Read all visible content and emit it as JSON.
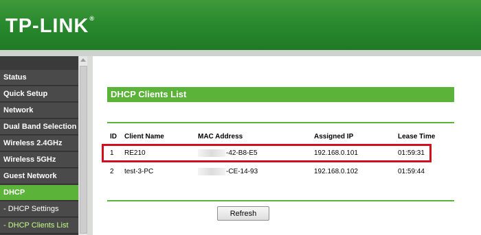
{
  "brand": {
    "logo_text": "TP-LINK",
    "trademark": "®"
  },
  "sidebar": {
    "items": [
      {
        "label": "Status"
      },
      {
        "label": "Quick Setup"
      },
      {
        "label": "Network"
      },
      {
        "label": "Dual Band Selection"
      },
      {
        "label": "Wireless 2.4GHz"
      },
      {
        "label": "Wireless 5GHz"
      },
      {
        "label": "Guest Network"
      },
      {
        "label": "DHCP",
        "active": true
      },
      {
        "label": "- DHCP Settings"
      },
      {
        "label": "- DHCP Clients List",
        "current": true
      }
    ]
  },
  "main": {
    "title": "DHCP Clients List",
    "table": {
      "headers": [
        "ID",
        "Client Name",
        "MAC Address",
        "Assigned IP",
        "Lease Time"
      ],
      "rows": [
        {
          "id": "1",
          "client_name": "RE210",
          "mac_suffix": "-42-B8-E5",
          "ip": "192.168.0.101",
          "lease": "01:59:31"
        },
        {
          "id": "2",
          "client_name": "test-3-PC",
          "mac_suffix": "-CE-14-93",
          "ip": "192.168.0.102",
          "lease": "01:59:44"
        }
      ]
    },
    "refresh_label": "Refresh"
  },
  "colors": {
    "accent": "#5bb33a",
    "header": "#2a8a2e",
    "highlight": "#d0101c"
  },
  "icons": {
    "sidebar_scroll_up": "arrow-up-icon"
  }
}
